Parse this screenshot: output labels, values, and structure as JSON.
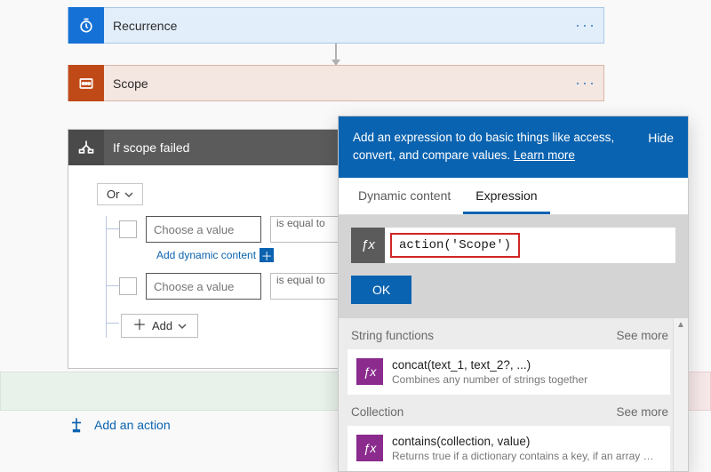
{
  "cards": {
    "recurrence": {
      "title": "Recurrence"
    },
    "scope": {
      "title": "Scope"
    }
  },
  "ifpanel": {
    "title": "If scope failed",
    "operator_label": "Or",
    "rows": [
      {
        "value_placeholder": "Choose a value",
        "op_label": "is equal to"
      },
      {
        "value_placeholder": "Choose a value",
        "op_label": "is equal to"
      }
    ],
    "dynamic_content_link": "Add dynamic content",
    "add_label": "Add"
  },
  "add_action_label": "Add an action",
  "flyout": {
    "header_text": "Add an expression to do basic things like access, convert, and compare values.",
    "learn_more": "Learn more",
    "hide": "Hide",
    "tabs": {
      "dynamic": "Dynamic content",
      "expression": "Expression"
    },
    "fx_value": "action('Scope')",
    "ok_label": "OK",
    "groups": [
      {
        "label": "String functions",
        "see_more": "See more",
        "items": [
          {
            "sig": "concat(text_1, text_2?, ...)",
            "desc": "Combines any number of strings together"
          }
        ]
      },
      {
        "label": "Collection",
        "see_more": "See more",
        "items": [
          {
            "sig": "contains(collection, value)",
            "desc": "Returns true if a dictionary contains a key, if an array cont…"
          }
        ]
      }
    ]
  }
}
